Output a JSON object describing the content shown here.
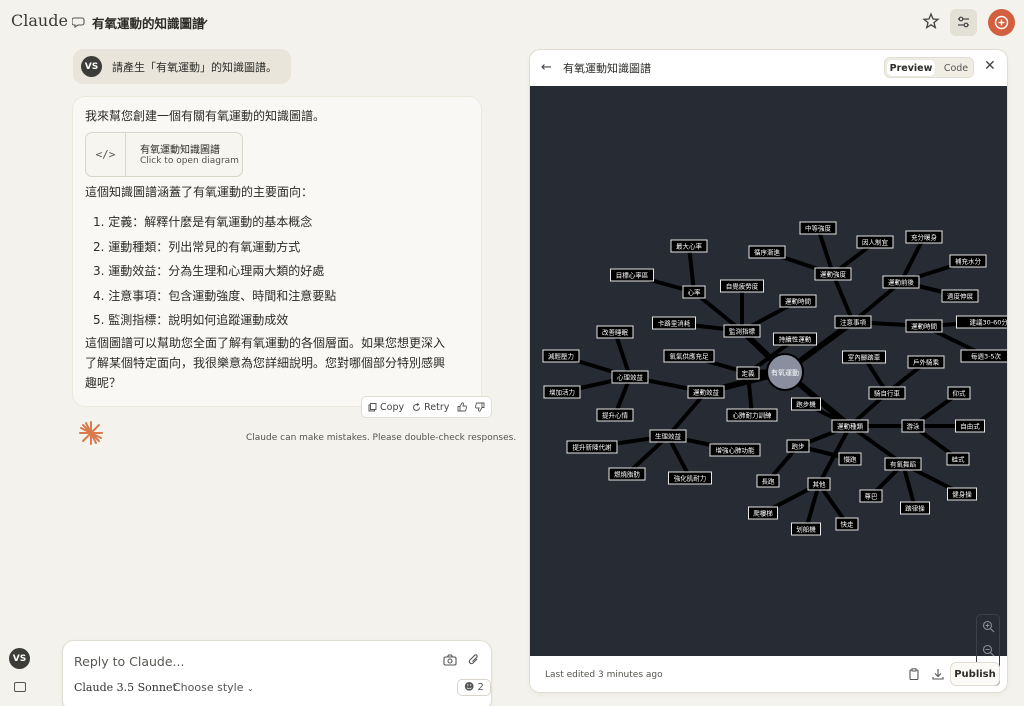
{
  "app": {
    "logo": "Claude",
    "conversation_title": "有氧運動的知識圖譜",
    "user_initials": "VS"
  },
  "user_message": "請產生「有氧運動」的知識圖譜。",
  "assistant": {
    "intro": "我來幫您創建一個有關有氧運動的知識圖譜。",
    "card_title": "有氧運動知識圖譜",
    "card_subtitle": "Click to open diagram",
    "summary": "這個知識圖譜涵蓋了有氧運動的主要面向：",
    "items": [
      "1. 定義：解釋什麼是有氧運動的基本概念",
      "2. 運動種類：列出常見的有氧運動方式",
      "3. 運動效益：分為生理和心理兩大類的好處",
      "4. 注意事項：包含運動強度、時間和注意要點",
      "5. 監測指標：說明如何追蹤運動成效"
    ],
    "closing_line1": "這個圖譜可以幫助您全面了解有氧運動的各個層面。如果您想更深入",
    "closing_line2": "了解某個特定面向，我很樂意為您詳細說明。您對哪個部分特別感興",
    "closing_line3": "趣呢？",
    "actions": {
      "copy": "Copy",
      "retry": "Retry"
    },
    "disclaimer": "Claude can make mistakes. Please double-check responses."
  },
  "composer": {
    "placeholder": "Reply to Claude...",
    "model": "Claude 3.5 Sonnet",
    "style": "Choose style",
    "badge": "2"
  },
  "panel": {
    "title": "有氧運動知識圖譜",
    "preview": "Preview",
    "code": "Code",
    "last_edited": "Last edited 3 minutes ago",
    "publish": "Publish"
  },
  "diagram": {
    "center": "有氧運動",
    "nodes": [
      {
        "id": "d",
        "label": "定義"
      },
      {
        "id": "sx",
        "label": "持續性運動"
      },
      {
        "id": "yq",
        "label": "氧氣供應充足"
      },
      {
        "id": "xf",
        "label": "心肺耐力訓練"
      },
      {
        "id": "ef",
        "label": "運動效益"
      },
      {
        "id": "xl",
        "label": "心理效益"
      },
      {
        "id": "jy",
        "label": "減輕壓力"
      },
      {
        "id": "zh",
        "label": "增加活力"
      },
      {
        "id": "gs",
        "label": "改善睡眠"
      },
      {
        "id": "tx",
        "label": "提升心情"
      },
      {
        "id": "sl",
        "label": "生理效益"
      },
      {
        "id": "ts",
        "label": "提升新陳代謝"
      },
      {
        "id": "rs",
        "label": "燃燒脂肪"
      },
      {
        "id": "jh",
        "label": "強化肌耐力"
      },
      {
        "id": "zq",
        "label": "增強心肺功能"
      },
      {
        "id": "jc",
        "label": "監測指標"
      },
      {
        "id": "xt",
        "label": "心率"
      },
      {
        "id": "zd",
        "label": "最大心率"
      },
      {
        "id": "mb",
        "label": "目標心率區"
      },
      {
        "id": "kl",
        "label": "卡路里消耗"
      },
      {
        "id": "zj",
        "label": "自覺疲勞度"
      },
      {
        "id": "ys",
        "label": "運動時間"
      },
      {
        "id": "zy",
        "label": "注意事項"
      },
      {
        "id": "qd",
        "label": "運動強度"
      },
      {
        "id": "zz",
        "label": "中等強度"
      },
      {
        "id": "xx",
        "label": "循序漸進"
      },
      {
        "id": "yr",
        "label": "因人制宜"
      },
      {
        "id": "qh",
        "label": "運動前後"
      },
      {
        "id": "cf",
        "label": "充分暖身"
      },
      {
        "id": "bc",
        "label": "補充水分"
      },
      {
        "id": "st",
        "label": "適度伸展"
      },
      {
        "id": "sj",
        "label": "運動時間"
      },
      {
        "id": "ms",
        "label": "建議30-60分鐘"
      },
      {
        "id": "mz",
        "label": "每週3-5次"
      },
      {
        "id": "zl",
        "label": "運動種類"
      },
      {
        "id": "sn",
        "label": "室內腳踏車"
      },
      {
        "id": "hw",
        "label": "戶外騎乘"
      },
      {
        "id": "qx",
        "label": "騎自行車"
      },
      {
        "id": "pb",
        "label": "跑步機"
      },
      {
        "id": "yy",
        "label": "游泳"
      },
      {
        "id": "ya",
        "label": "仰式"
      },
      {
        "id": "zx",
        "label": "自由式"
      },
      {
        "id": "wa",
        "label": "蛙式"
      },
      {
        "id": "pa",
        "label": "跑步"
      },
      {
        "id": "mp",
        "label": "慢跑"
      },
      {
        "id": "cp",
        "label": "長跑"
      },
      {
        "id": "qt",
        "label": "其他"
      },
      {
        "id": "tw",
        "label": "有氧舞蹈"
      },
      {
        "id": "zu",
        "label": "尊巴"
      },
      {
        "id": "jl",
        "label": "踏律操"
      },
      {
        "id": "js",
        "label": "健身操"
      },
      {
        "id": "pm",
        "label": "爬樓梯"
      },
      {
        "id": "hc",
        "label": "划船機"
      },
      {
        "id": "kz",
        "label": "快走"
      }
    ],
    "edges": [
      [
        "c",
        "d"
      ],
      [
        "d",
        "sx"
      ],
      [
        "d",
        "yq"
      ],
      [
        "d",
        "xf"
      ],
      [
        "c",
        "ef"
      ],
      [
        "ef",
        "xl"
      ],
      [
        "xl",
        "jy"
      ],
      [
        "xl",
        "zh"
      ],
      [
        "xl",
        "gs"
      ],
      [
        "xl",
        "tx"
      ],
      [
        "ef",
        "sl"
      ],
      [
        "sl",
        "ts"
      ],
      [
        "sl",
        "rs"
      ],
      [
        "sl",
        "jh"
      ],
      [
        "sl",
        "zq"
      ],
      [
        "c",
        "jc"
      ],
      [
        "jc",
        "xt"
      ],
      [
        "xt",
        "zd"
      ],
      [
        "xt",
        "mb"
      ],
      [
        "jc",
        "kl"
      ],
      [
        "jc",
        "zj"
      ],
      [
        "jc",
        "ys"
      ],
      [
        "c",
        "zy"
      ],
      [
        "zy",
        "qd"
      ],
      [
        "qd",
        "zz"
      ],
      [
        "qd",
        "xx"
      ],
      [
        "qd",
        "yr"
      ],
      [
        "zy",
        "qh"
      ],
      [
        "qh",
        "cf"
      ],
      [
        "qh",
        "bc"
      ],
      [
        "qh",
        "st"
      ],
      [
        "zy",
        "sj"
      ],
      [
        "sj",
        "ms"
      ],
      [
        "sj",
        "mz"
      ],
      [
        "c",
        "zl"
      ],
      [
        "zl",
        "pb"
      ],
      [
        "zl",
        "qx"
      ],
      [
        "qx",
        "sn"
      ],
      [
        "qx",
        "hw"
      ],
      [
        "zl",
        "yy"
      ],
      [
        "yy",
        "ya"
      ],
      [
        "yy",
        "zx"
      ],
      [
        "yy",
        "wa"
      ],
      [
        "zl",
        "pa"
      ],
      [
        "pa",
        "mp"
      ],
      [
        "pa",
        "cp"
      ],
      [
        "zl",
        "qt"
      ],
      [
        "qt",
        "pm"
      ],
      [
        "qt",
        "hc"
      ],
      [
        "qt",
        "kz"
      ],
      [
        "zl",
        "tw"
      ],
      [
        "tw",
        "zu"
      ],
      [
        "tw",
        "jl"
      ],
      [
        "tw",
        "js"
      ]
    ]
  },
  "icons": {
    "chat": "chat-bubble-icon",
    "chevron": "chevron-down-icon",
    "star": "star-icon",
    "tune": "sliders-icon",
    "code": "code-icon",
    "copy": "copy-icon",
    "retry": "retry-icon",
    "thumbs_up": "thumbs-up-icon",
    "thumbs_down": "thumbs-down-icon",
    "spark": "claude-spark-icon",
    "camera": "camera-icon",
    "attach": "paperclip-icon",
    "back": "arrow-left-icon",
    "close": "close-icon",
    "clipboard": "clipboard-icon",
    "download": "download-icon"
  },
  "colors": {
    "accent": "#d2603f",
    "diagram_bg": "#272b33",
    "center_node": "#8a8fa0"
  }
}
